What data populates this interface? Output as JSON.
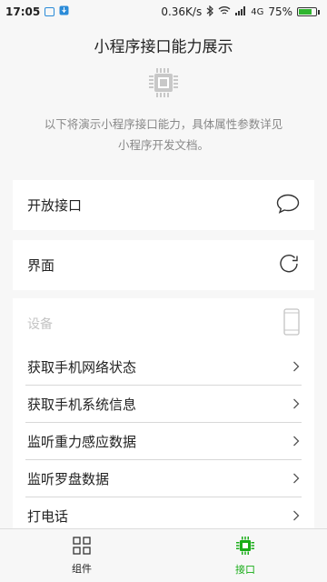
{
  "status_bar": {
    "time": "17:05",
    "network_speed": "0.36K/s",
    "network_type": "4G",
    "battery_percent": "75%",
    "battery_level": 0.75,
    "icons": [
      "notification-icon",
      "usb-icon",
      "bluetooth-icon",
      "wifi-icon",
      "signal-icon",
      "battery-icon"
    ]
  },
  "header": {
    "title": "小程序接口能力展示",
    "icon": "chip-icon",
    "description_line1": "以下将演示小程序接口能力，具体属性参数详见",
    "description_line2": "小程序开发文档。"
  },
  "cards": {
    "open_api": {
      "label": "开放接口",
      "icon": "chat-bubble-icon"
    },
    "interface": {
      "label": "界面",
      "icon": "refresh-icon"
    }
  },
  "device_group": {
    "label": "设备",
    "icon": "phone-icon",
    "items": [
      {
        "label": "获取手机网络状态"
      },
      {
        "label": "获取手机系统信息"
      },
      {
        "label": "监听重力感应数据"
      },
      {
        "label": "监听罗盘数据"
      },
      {
        "label": "打电话"
      }
    ]
  },
  "tab_bar": {
    "tabs": [
      {
        "label": "组件",
        "icon": "grid-icon",
        "active": false
      },
      {
        "label": "接口",
        "icon": "chip-icon",
        "active": true
      }
    ],
    "active_color": "#1aad19",
    "inactive_color": "#222222"
  }
}
